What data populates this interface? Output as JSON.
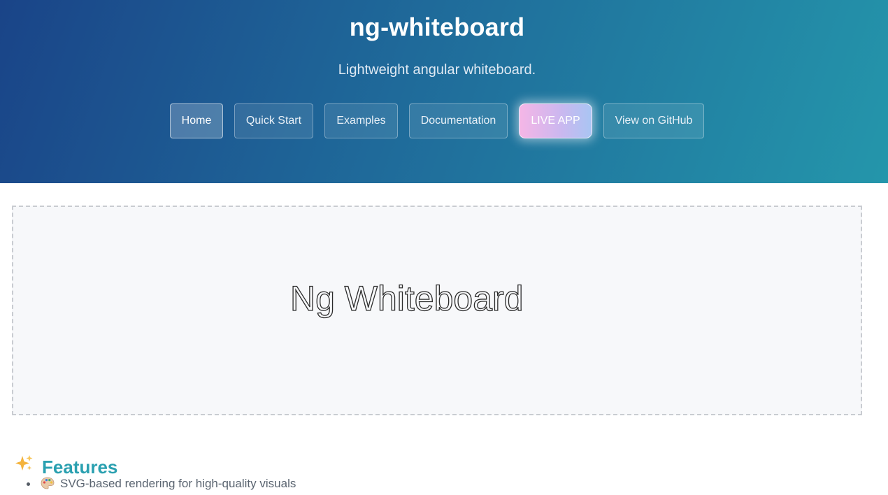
{
  "header": {
    "title": "ng-whiteboard",
    "subtitle": "Lightweight angular whiteboard."
  },
  "nav": {
    "home": "Home",
    "quick_start": "Quick Start",
    "examples": "Examples",
    "documentation": "Documentation",
    "live_app": "LIVE APP",
    "github": "View on GitHub"
  },
  "demo": {
    "text": "Ng Whiteboard"
  },
  "features": {
    "heading": "Features",
    "heading_icon": "sparkles-icon",
    "items": [
      {
        "icon": "palette-icon",
        "text": "SVG-based rendering for high-quality visuals"
      }
    ]
  },
  "colors": {
    "hero_gradient_start": "#1a4488",
    "hero_gradient_end": "#2496ab",
    "features_heading": "#2aa0b0",
    "live_gradient_start": "#f5b6e6",
    "live_gradient_end": "#a9c5f3"
  }
}
